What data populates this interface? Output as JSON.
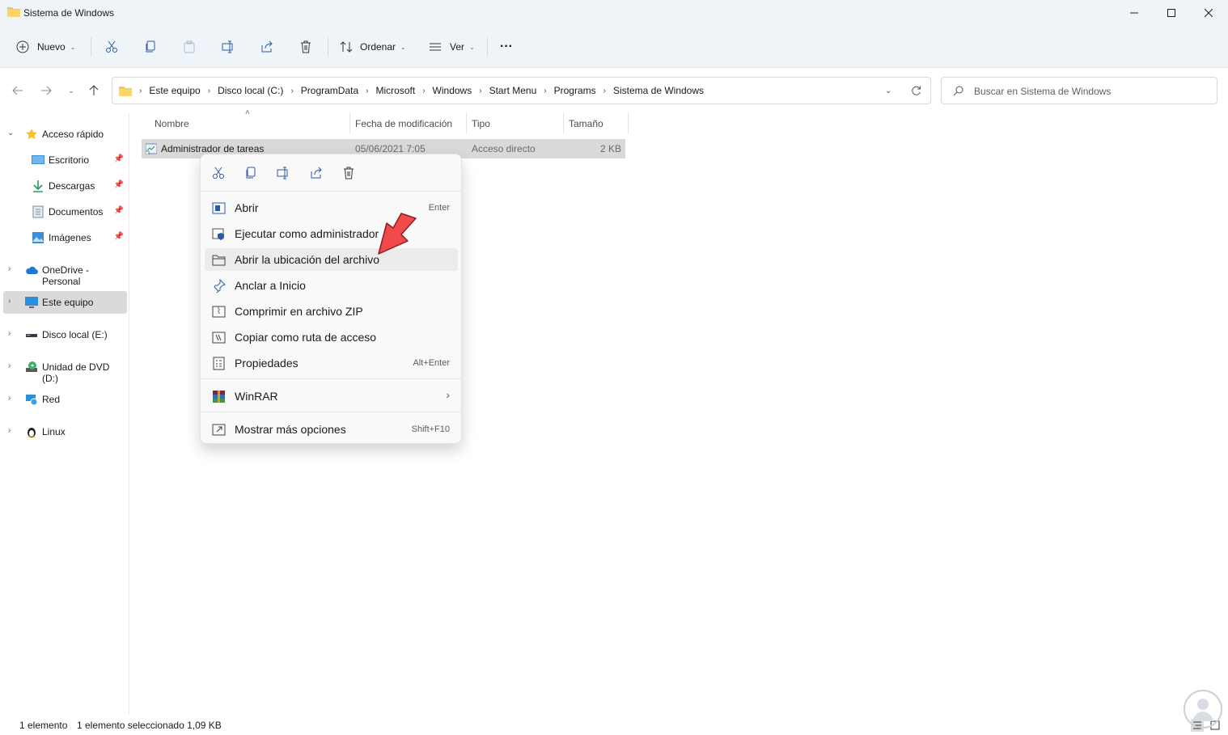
{
  "window": {
    "title": "Sistema de Windows"
  },
  "toolbar": {
    "new_label": "Nuevo",
    "sort_label": "Ordenar",
    "view_label": "Ver",
    "more_label": "···"
  },
  "address": {
    "crumbs": [
      "Este equipo",
      "Disco local (C:)",
      "ProgramData",
      "Microsoft",
      "Windows",
      "Start Menu",
      "Programs",
      "Sistema de Windows"
    ],
    "search_placeholder": "Buscar en Sistema de Windows"
  },
  "sidebar": {
    "items": [
      {
        "label": "Acceso rápido",
        "icon": "star-icon"
      },
      {
        "label": "Escritorio",
        "icon": "desktop-icon"
      },
      {
        "label": "Descargas",
        "icon": "download-icon"
      },
      {
        "label": "Documentos",
        "icon": "document-icon"
      },
      {
        "label": "Imágenes",
        "icon": "pictures-icon"
      },
      {
        "label": "OneDrive - Personal",
        "icon": "cloud-icon"
      },
      {
        "label": "Este equipo",
        "icon": "computer-icon"
      },
      {
        "label": "Disco local (E:)",
        "icon": "drive-icon"
      },
      {
        "label": "Unidad de DVD (D:)",
        "icon": "dvd-icon"
      },
      {
        "label": "Red",
        "icon": "network-icon"
      },
      {
        "label": "Linux",
        "icon": "linux-icon"
      }
    ]
  },
  "columns": {
    "name": "Nombre",
    "modified": "Fecha de modificación",
    "type": "Tipo",
    "size": "Tamaño"
  },
  "files": [
    {
      "name": "Administrador de tareas",
      "modified": "05/06/2021 7:05",
      "type": "Acceso directo",
      "size": "2 KB"
    }
  ],
  "context_menu": {
    "items": [
      {
        "label": "Abrir",
        "shortcut": "Enter",
        "icon": "open-icon"
      },
      {
        "label": "Ejecutar como administrador",
        "shortcut": "",
        "icon": "shield-icon"
      },
      {
        "label": "Abrir la ubicación del archivo",
        "shortcut": "",
        "icon": "folder-icon"
      },
      {
        "label": "Anclar a Inicio",
        "shortcut": "",
        "icon": "pin-icon"
      },
      {
        "label": "Comprimir en archivo ZIP",
        "shortcut": "",
        "icon": "zip-icon"
      },
      {
        "label": "Copiar como ruta de acceso",
        "shortcut": "",
        "icon": "path-icon"
      },
      {
        "label": "Propiedades",
        "shortcut": "Alt+Enter",
        "icon": "properties-icon"
      },
      {
        "label": "WinRAR",
        "shortcut": "›",
        "icon": "winrar-icon"
      },
      {
        "label": "Mostrar más opciones",
        "shortcut": "Shift+F10",
        "icon": "more-options-icon"
      }
    ]
  },
  "status": {
    "count": "1 elemento",
    "selection": "1 elemento seleccionado  1,09 KB"
  },
  "colors": {
    "chrome": "#eff4f9",
    "selection": "#d9d9d9",
    "arrow": "#f04a4a",
    "folder": "#f8c94a"
  }
}
